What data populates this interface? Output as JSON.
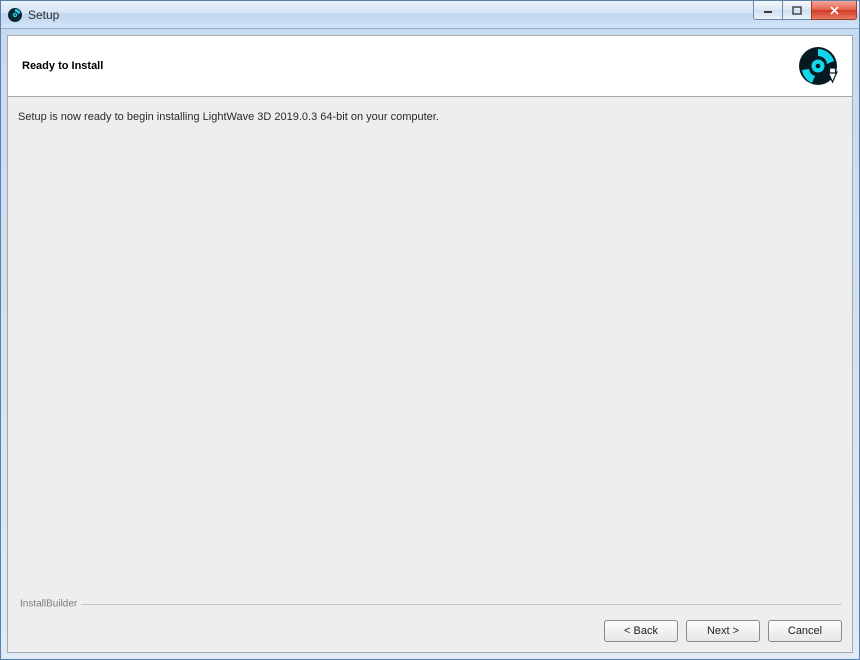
{
  "window": {
    "title": "Setup"
  },
  "header": {
    "heading": "Ready to Install"
  },
  "body": {
    "message": "Setup is now ready to begin installing LightWave 3D 2019.0.3 64-bit on your computer."
  },
  "footer": {
    "builder_label": "InstallBuilder",
    "back_label": "< Back",
    "next_label": "Next >",
    "cancel_label": "Cancel"
  }
}
